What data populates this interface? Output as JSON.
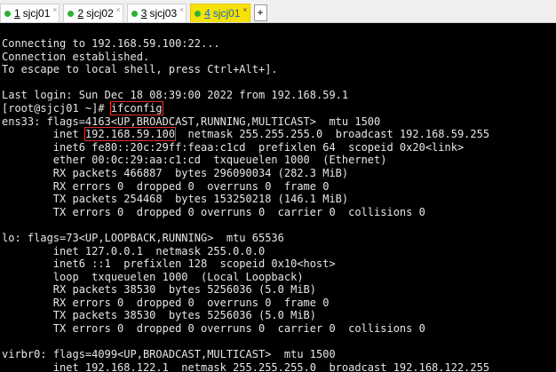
{
  "tabs": [
    {
      "num": "1",
      "label": " sjcj01",
      "active": false
    },
    {
      "num": "2",
      "label": " sjcj02",
      "active": false
    },
    {
      "num": "3",
      "label": " sjcj03",
      "active": false
    },
    {
      "num": "4",
      "label": " sjcj01",
      "active": true
    }
  ],
  "tab_close_glyph": "×",
  "tab_add_glyph": "+",
  "colors": {
    "terminal_bg": "#000000",
    "terminal_fg": "#e6e6e6",
    "active_tab_bg": "#f6e10a",
    "active_tab_fg": "#0b6ad0",
    "status_dot": "#2fb12f",
    "highlight_box": "#e03030"
  },
  "terminal": {
    "l01": "",
    "l02": "Connecting to 192.168.59.100:22...",
    "l03": "Connection established.",
    "l04": "To escape to local shell, press Ctrl+Alt+].",
    "l05": "",
    "l06": "Last login: Sun Dec 18 08:39:00 2022 from 192.168.59.1",
    "l07_prompt": "[root@sjcj01 ~]# ",
    "l07_cmd": "ifconfig",
    "l08": "ens33: flags=4163<UP,BROADCAST,RUNNING,MULTICAST>  mtu 1500",
    "l09_pre": "        inet ",
    "l09_ip": "192.168.59.100",
    "l09_post": "  netmask 255.255.255.0  broadcast 192.168.59.255",
    "l10": "        inet6 fe80::20c:29ff:feaa:c1cd  prefixlen 64  scopeid 0x20<link>",
    "l11": "        ether 00:0c:29:aa:c1:cd  txqueuelen 1000  (Ethernet)",
    "l12": "        RX packets 466887  bytes 296090034 (282.3 MiB)",
    "l13": "        RX errors 0  dropped 0  overruns 0  frame 0",
    "l14": "        TX packets 254468  bytes 153250218 (146.1 MiB)",
    "l15": "        TX errors 0  dropped 0 overruns 0  carrier 0  collisions 0",
    "l16": "",
    "l17": "lo: flags=73<UP,LOOPBACK,RUNNING>  mtu 65536",
    "l18": "        inet 127.0.0.1  netmask 255.0.0.0",
    "l19": "        inet6 ::1  prefixlen 128  scopeid 0x10<host>",
    "l20": "        loop  txqueuelen 1000  (Local Loopback)",
    "l21": "        RX packets 38530  bytes 5256036 (5.0 MiB)",
    "l22": "        RX errors 0  dropped 0  overruns 0  frame 0",
    "l23": "        TX packets 38530  bytes 5256036 (5.0 MiB)",
    "l24": "        TX errors 0  dropped 0 overruns 0  carrier 0  collisions 0",
    "l25": "",
    "l26": "virbr0: flags=4099<UP,BROADCAST,MULTICAST>  mtu 1500",
    "l27": "        inet 192.168.122.1  netmask 255.255.255.0  broadcast 192.168.122.255"
  }
}
